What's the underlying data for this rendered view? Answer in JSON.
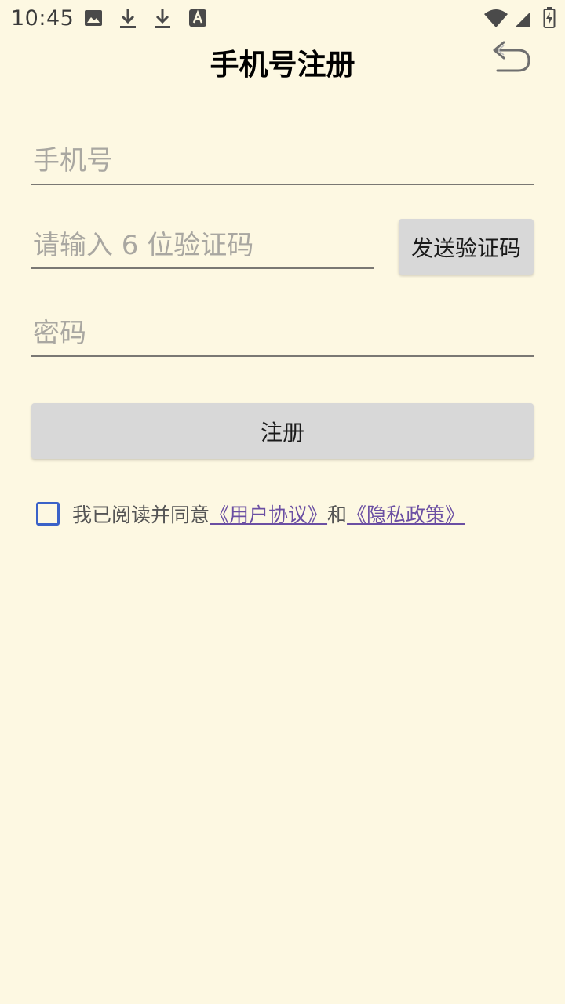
{
  "status_bar": {
    "time": "10:45",
    "left_icons": [
      "image-icon",
      "download-icon",
      "download-icon",
      "text-a-icon"
    ],
    "right_icons": [
      "wifi-icon",
      "signal-icon",
      "battery-icon"
    ]
  },
  "header": {
    "title": "手机号注册",
    "back_icon": "back-arrow-icon"
  },
  "form": {
    "phone_placeholder": "手机号",
    "code_placeholder": "请输入 6 位验证码",
    "password_placeholder": "密码",
    "send_code_label": "发送验证码",
    "register_label": "注册"
  },
  "agreement": {
    "checked": false,
    "prefix": "我已阅读并同意",
    "user_agreement": "《用户协议》",
    "conjunction": "和",
    "privacy_policy": "《隐私政策》"
  },
  "colors": {
    "background": "#fdf8e2",
    "button": "#d8d8d8",
    "checkbox": "#3b62c8",
    "link": "#6b4fa3"
  }
}
